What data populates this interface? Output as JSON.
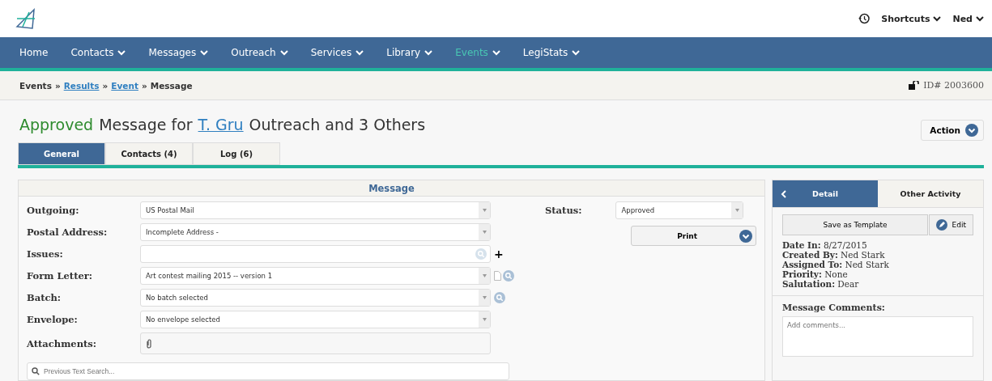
{
  "topbar": {
    "shortcuts": "Shortcuts",
    "user": "Ned"
  },
  "nav": [
    {
      "label": "Home",
      "dropdown": false,
      "selected": false
    },
    {
      "label": "Contacts",
      "dropdown": true,
      "selected": false
    },
    {
      "label": "Messages",
      "dropdown": true,
      "selected": false
    },
    {
      "label": "Outreach",
      "dropdown": true,
      "selected": false
    },
    {
      "label": "Services",
      "dropdown": true,
      "selected": false
    },
    {
      "label": "Library",
      "dropdown": true,
      "selected": false
    },
    {
      "label": "Events",
      "dropdown": true,
      "selected": true
    },
    {
      "label": "LegiStats",
      "dropdown": true,
      "selected": false
    }
  ],
  "breadcrumb": [
    {
      "label": "Events",
      "kind": "text"
    },
    {
      "label": "»",
      "kind": "sep"
    },
    {
      "label": "Results",
      "kind": "link"
    },
    {
      "label": "»",
      "kind": "sep"
    },
    {
      "label": "Event",
      "kind": "link"
    },
    {
      "label": "»",
      "kind": "sep"
    },
    {
      "label": "Message",
      "kind": "text"
    }
  ],
  "record_id": "ID# 2003600",
  "title": {
    "status": "Approved",
    "prefix": "Message for",
    "link": "T. Gru",
    "suffix": "Outreach and 3 Others"
  },
  "action_button": "Action",
  "tabs": [
    {
      "label": "General",
      "selected": true
    },
    {
      "label": "Contacts (4)",
      "selected": false
    },
    {
      "label": "Log (6)",
      "selected": false
    }
  ],
  "message_panel": {
    "title": "Message",
    "fields": [
      {
        "label": "Outgoing:",
        "value": "US Postal Mail",
        "kind": "select"
      },
      {
        "label": "Postal Address:",
        "value": "Incomplete Address -",
        "kind": "select"
      },
      {
        "label": "Issues:",
        "kind": "lookup",
        "add": "+"
      },
      {
        "label": "Form Letter:",
        "value": "Art contest mailing 2015 -- version 1",
        "kind": "template-select"
      },
      {
        "label": "Batch:",
        "value": "No batch selected",
        "kind": "search-select"
      },
      {
        "label": "Envelope:",
        "value": "No envelope selected",
        "kind": "select"
      },
      {
        "label": "Attachments:",
        "kind": "attachments"
      }
    ],
    "status_label": "Status:",
    "status_value": "Approved",
    "print_button": "Print",
    "search_placeholder": "Previous Text Search..."
  },
  "side_panel": {
    "tabs": [
      {
        "label": "Detail",
        "selected": true
      },
      {
        "label": "Other Activity",
        "selected": false
      }
    ],
    "template_button": "Save as Template",
    "edit_button": "Edit",
    "details": [
      {
        "label": "Date In:",
        "value": "8/27/2015"
      },
      {
        "label": "Created By:",
        "value": "Ned Stark"
      },
      {
        "label": "Assigned To:",
        "value": "Ned Stark"
      },
      {
        "label": "Priority:",
        "value": "None"
      },
      {
        "label": "Salutation:",
        "value": "Dear"
      }
    ],
    "comments_label": "Message Comments:",
    "comments_placeholder": "Add comments..."
  }
}
